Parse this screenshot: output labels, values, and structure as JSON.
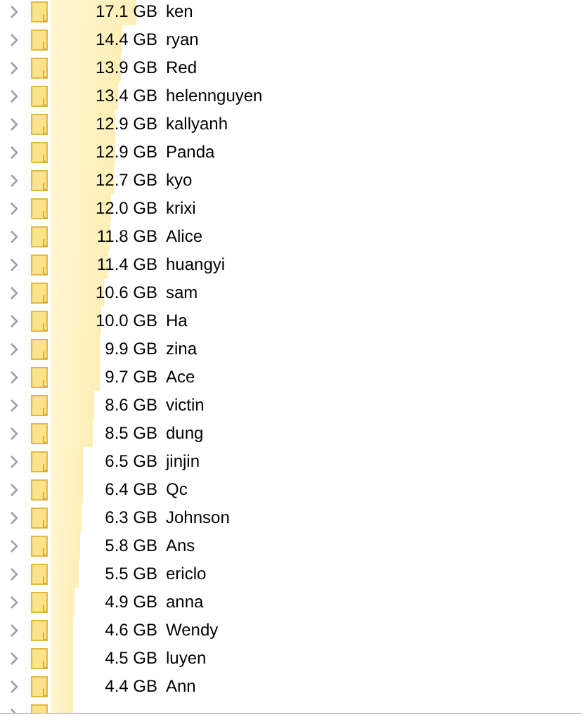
{
  "folders": [
    {
      "kind": "row",
      "size": "17.1 GB",
      "name": "ken"
    },
    {
      "kind": "row",
      "size": "14.4 GB",
      "name": "ryan"
    },
    {
      "kind": "row",
      "size": "13.9 GB",
      "name": "Red"
    },
    {
      "kind": "row",
      "size": "13.4 GB",
      "name": "helennguyen"
    },
    {
      "kind": "row",
      "size": "12.9 GB",
      "name": "kallyanh"
    },
    {
      "kind": "row",
      "size": "12.9 GB",
      "name": "Panda"
    },
    {
      "kind": "row",
      "size": "12.7 GB",
      "name": "kyo"
    },
    {
      "kind": "row",
      "size": "12.0 GB",
      "name": "krixi"
    },
    {
      "kind": "row",
      "size": "11.8 GB",
      "name": "Alice"
    },
    {
      "kind": "row",
      "size": "11.4 GB",
      "name": "huangyi"
    },
    {
      "kind": "row",
      "size": "10.6 GB",
      "name": "sam"
    },
    {
      "kind": "row",
      "size": "10.0 GB",
      "name": "Ha"
    },
    {
      "kind": "row",
      "size": "9.9 GB",
      "name": "zina"
    },
    {
      "kind": "row",
      "size": "9.7 GB",
      "name": "Ace"
    },
    {
      "kind": "row",
      "size": "8.6 GB",
      "name": "victin"
    },
    {
      "kind": "row",
      "size": "8.5 GB",
      "name": "dung"
    },
    {
      "kind": "row",
      "size": "6.5 GB",
      "name": "jinjin"
    },
    {
      "kind": "row",
      "size": "6.4 GB",
      "name": "Qc"
    },
    {
      "kind": "row",
      "size": "6.3 GB",
      "name": "Johnson"
    },
    {
      "kind": "row",
      "size": "5.8 GB",
      "name": "Ans"
    },
    {
      "kind": "row",
      "size": "5.5 GB",
      "name": "ericlo"
    },
    {
      "kind": "row",
      "size": "4.9 GB",
      "name": "anna"
    },
    {
      "kind": "row",
      "size": "4.6 GB",
      "name": "Wendy"
    },
    {
      "kind": "row",
      "size": "4.5 GB",
      "name": "luyen"
    },
    {
      "kind": "row",
      "size": "4.4 GB",
      "name": "Ann"
    },
    {
      "kind": "cut"
    }
  ]
}
